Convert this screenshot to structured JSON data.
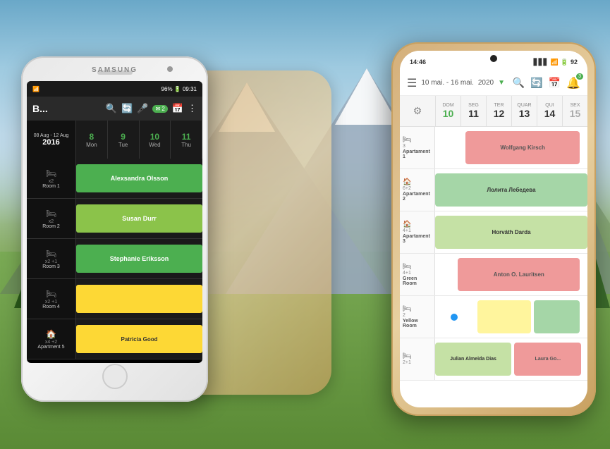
{
  "background": {
    "sky_color": "#6AA8C8",
    "ground_color": "#5A8A35"
  },
  "samsung_phone": {
    "brand": "SAMSUNG",
    "status_bar": {
      "wifi": "WiFi",
      "signal": "4G",
      "battery": "96%",
      "time": "09:31"
    },
    "toolbar": {
      "title": "B...",
      "icons": [
        "search",
        "refresh",
        "mic-off",
        "mail",
        "calendar",
        "more"
      ]
    },
    "calendar_header": {
      "date_range": "08 Aug - 12 Aug",
      "year": "2016",
      "days": [
        {
          "num": "8",
          "name": "Mon"
        },
        {
          "num": "9",
          "name": "Tue"
        },
        {
          "num": "10",
          "name": "Wed"
        },
        {
          "num": "11",
          "name": "Thu"
        }
      ]
    },
    "rooms": [
      {
        "icon": "🛏",
        "capacity": "x2",
        "name": "Room 1",
        "booking": "Alexsandra Olsson",
        "color": "green"
      },
      {
        "icon": "🛏",
        "capacity": "x2",
        "name": "Room 2",
        "booking": "Susan Durr",
        "color": "lime"
      },
      {
        "icon": "🛏",
        "capacity": "x2 +1",
        "name": "Room 3",
        "booking": "Stephanie Eriksson",
        "color": "green"
      },
      {
        "icon": "🛏",
        "capacity": "x2 +1",
        "name": "Room 4",
        "booking": "",
        "color": "yellow"
      },
      {
        "icon": "🏠",
        "capacity": "x4 +2",
        "name": "Apartment 5",
        "booking": "Patricia Good",
        "color": "yellow"
      }
    ]
  },
  "modern_phone": {
    "status_bar": {
      "time": "14:46",
      "signal": "4G",
      "wifi": "WiFi",
      "battery": "92"
    },
    "toolbar": {
      "date": "10 mai. - 16 mai.",
      "year": "2020",
      "icons": [
        "menu",
        "search",
        "refresh",
        "calendar",
        "bell"
      ],
      "bell_badge": "3"
    },
    "calendar_header": {
      "days": [
        {
          "name": "DOM",
          "num": "10",
          "today": true
        },
        {
          "name": "SEG",
          "num": "11"
        },
        {
          "name": "TER",
          "num": "12"
        },
        {
          "name": "QUAR",
          "num": "13"
        },
        {
          "name": "QUI",
          "num": "14"
        },
        {
          "name": "SEX",
          "num": "15",
          "weekend": true
        }
      ]
    },
    "rooms": [
      {
        "icon": "🛏",
        "capacity": "3",
        "name": "Apartament 1",
        "bookings": [
          {
            "text": "Wolfgang Kirsch",
            "color": "pink",
            "left": "20%",
            "width": "75%"
          }
        ]
      },
      {
        "icon": "🏠",
        "capacity": "6+2",
        "name": "Apartament 2",
        "bookings": [
          {
            "text": "Лолита Лебедева",
            "color": "green",
            "left": "0%",
            "width": "100%"
          }
        ]
      },
      {
        "icon": "🏠",
        "capacity": "4+1",
        "name": "Apartament 3",
        "bookings": [
          {
            "text": "Horváth Darda",
            "color": "lime",
            "left": "0%",
            "width": "100%"
          }
        ]
      },
      {
        "icon": "🛏",
        "capacity": "4+1",
        "name": "Green Room",
        "bookings": [
          {
            "text": "Anton O. Lauritsen",
            "color": "pink",
            "left": "15%",
            "width": "80%"
          }
        ]
      },
      {
        "icon": "🛏",
        "capacity": "2",
        "name": "Yellow Room",
        "bookings": [
          {
            "text": "",
            "color": "blue-dot",
            "left": "10%",
            "width": "15%"
          },
          {
            "text": "",
            "color": "yellow",
            "left": "28%",
            "width": "35%"
          },
          {
            "text": "",
            "color": "green",
            "left": "65%",
            "width": "30%"
          }
        ]
      },
      {
        "icon": "🛏",
        "capacity": "2+1",
        "name": "",
        "bookings": [
          {
            "text": "Julian Almeida Dias",
            "color": "lime",
            "left": "0%",
            "width": "55%"
          },
          {
            "text": "Laura Go...",
            "color": "pink",
            "left": "57%",
            "width": "40%"
          }
        ]
      }
    ]
  }
}
